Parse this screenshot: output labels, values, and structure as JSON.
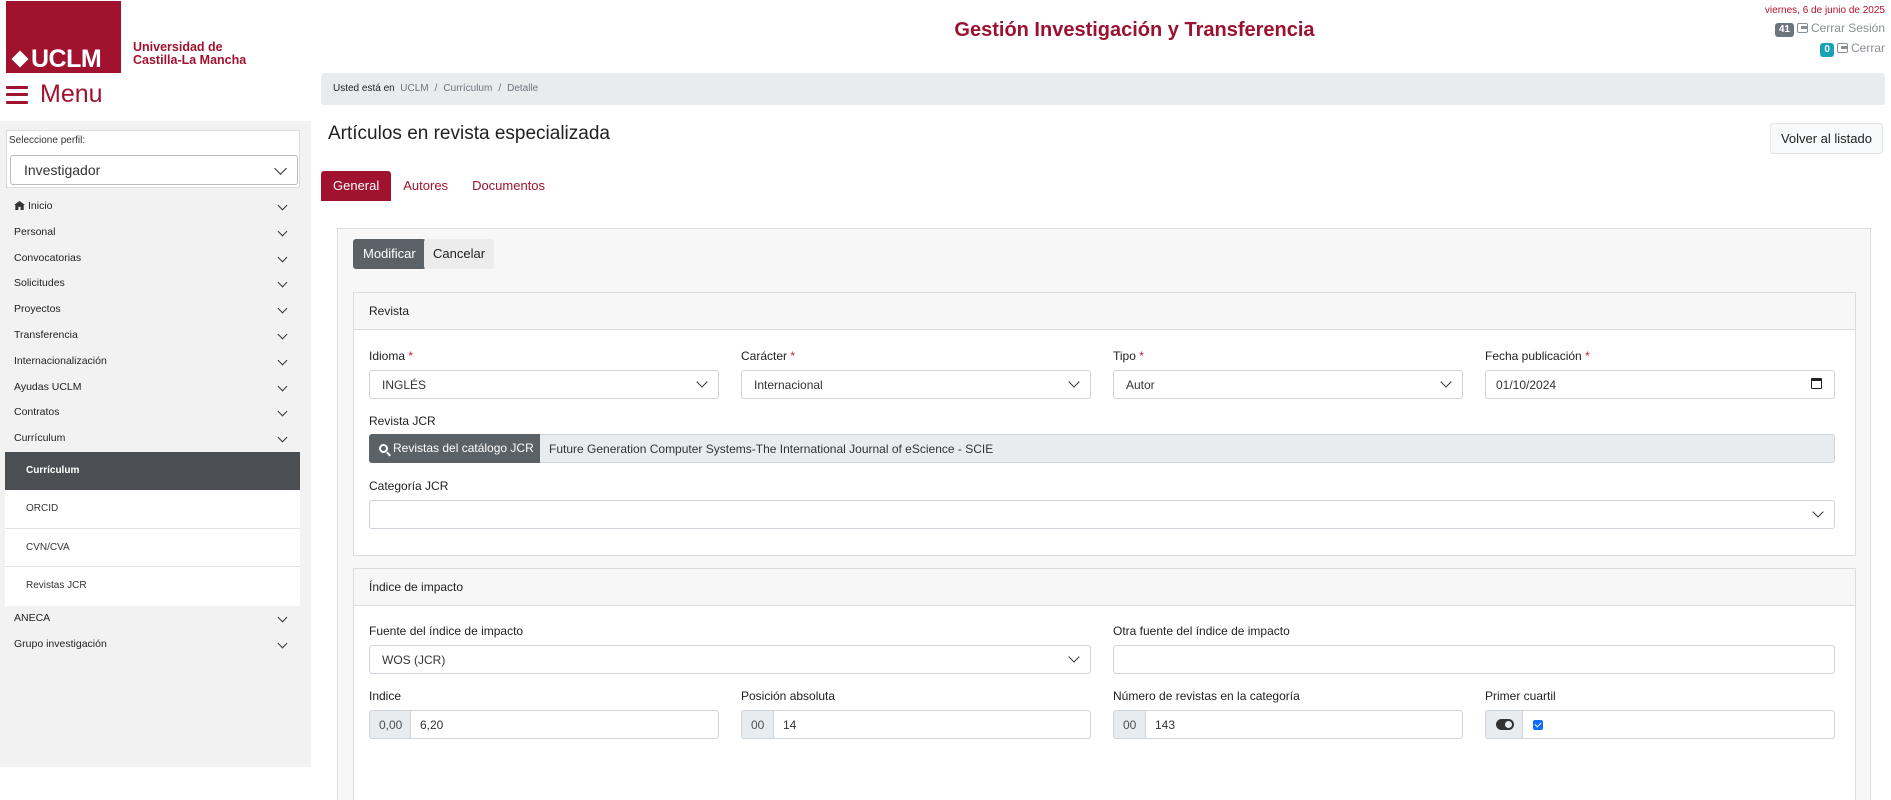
{
  "header": {
    "logo_text": "UCLM",
    "uni_line1": "Universidad de",
    "uni_line2": "Castilla-La Mancha",
    "app_title": "Gestión Investigación y Transferencia",
    "date": "viernes, 6 de junio de 2025",
    "session_badge": "41",
    "session_label": "Cerrar Sesión",
    "close_badge": "0",
    "close_label": "Cerrar"
  },
  "menu": {
    "label": "Menu"
  },
  "sidebar": {
    "profile_label": "Seleccione perfil:",
    "profile_value": "Investigador",
    "items": [
      {
        "label": "Inicio"
      },
      {
        "label": "Personal"
      },
      {
        "label": "Convocatorias"
      },
      {
        "label": "Solicitudes"
      },
      {
        "label": "Proyectos"
      },
      {
        "label": "Transferencia"
      },
      {
        "label": "Internacionalización"
      },
      {
        "label": "Ayudas UCLM"
      },
      {
        "label": "Contratos"
      },
      {
        "label": "Currículum"
      }
    ],
    "subitems": [
      {
        "label": "Currículum"
      },
      {
        "label": "ORCID"
      },
      {
        "label": "CVN/CVA"
      },
      {
        "label": "Revistas JCR"
      }
    ],
    "items_after": [
      {
        "label": "ANECA"
      },
      {
        "label": "Grupo investigación"
      }
    ]
  },
  "breadcrumb": {
    "prefix": "Usted está en",
    "items": [
      "UCLM",
      "Currículum",
      "Detalle"
    ]
  },
  "page": {
    "title": "Artículos en revista especializada",
    "back_button": "Volver al listado",
    "tabs": [
      "General",
      "Autores",
      "Documentos"
    ]
  },
  "actions": {
    "modify": "Modificar",
    "cancel": "Cancelar"
  },
  "revista": {
    "header": "Revista",
    "idioma_label": "Idioma",
    "idioma_value": "INGLÉS",
    "caracter_label": "Carácter",
    "caracter_value": "Internacional",
    "tipo_label": "Tipo",
    "tipo_value": "Autor",
    "fecha_label": "Fecha publicación",
    "fecha_value": "01/10/2024",
    "required_mark": "*",
    "jcr_label": "Revista JCR",
    "jcr_button": "Revistas del catálogo JCR",
    "jcr_value": "Future Generation Computer Systems-The International Journal of eScience - SCIE",
    "categoria_label": "Categoría JCR",
    "categoria_value": ""
  },
  "impacto": {
    "header": "Índice de impacto",
    "fuente_label": "Fuente del índice de impacto",
    "fuente_value": "WOS (JCR)",
    "otra_label": "Otra fuente del índice de impacto",
    "otra_value": "",
    "indice_label": "Indice",
    "indice_prefix": "0,00",
    "indice_value": "6,20",
    "posicion_label": "Posición absoluta",
    "posicion_prefix": "00",
    "posicion_value": "14",
    "numero_label": "Número de revistas en la categoría",
    "numero_prefix": "00",
    "numero_value": "143",
    "cuartil_label": "Primer cuartil",
    "cuartil_checked": true
  }
}
